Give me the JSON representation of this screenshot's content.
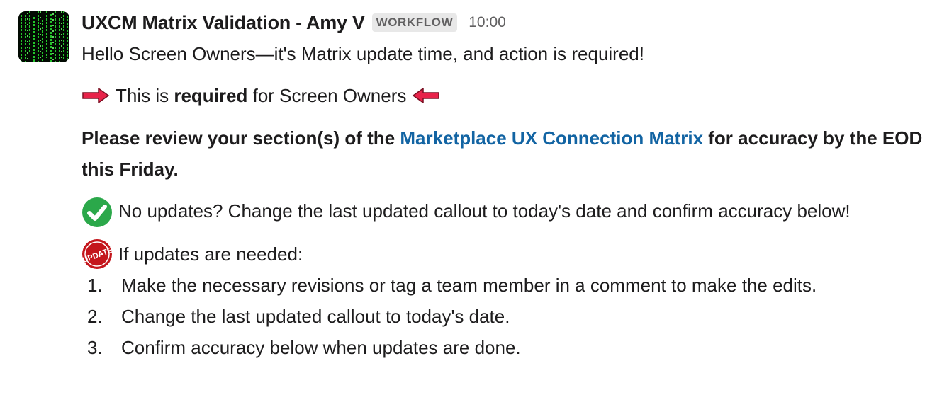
{
  "message": {
    "sender": "UXCM Matrix Validation - Amy V",
    "badge": "WORKFLOW",
    "timestamp": "10:00",
    "greeting": "Hello Screen Owners—it's Matrix update time, and action is required!",
    "required_line": {
      "prefix": "This is ",
      "bold": "required",
      "suffix": " for Screen Owners",
      "left_emoji": "red-arrow-right-icon",
      "right_emoji": "red-arrow-left-icon"
    },
    "review": {
      "prefix": "Please review your section(s) of the ",
      "link_text": "Marketplace UX Connection Matrix",
      "suffix": " for accuracy by the EOD this Friday."
    },
    "no_updates": {
      "emoji": "green-check-icon",
      "text": "No updates? Change the last updated callout to today's date and confirm accuracy below!"
    },
    "if_updates": {
      "emoji": "update-stamp-icon",
      "emoji_text": "UPDATE",
      "text": "If updates are needed:"
    },
    "steps": [
      {
        "num": "1.",
        "text": "Make the necessary revisions or tag a team member in a comment to make the edits."
      },
      {
        "num": "2.",
        "text": "Change the last updated callout to today's date."
      },
      {
        "num": "3.",
        "text": "Confirm accuracy below when updates are done."
      }
    ]
  },
  "colors": {
    "link": "#1264a3",
    "text": "#1d1c1d",
    "muted": "#616061",
    "check_green": "#2ba84a",
    "arrow_red": "#e01e5a"
  }
}
